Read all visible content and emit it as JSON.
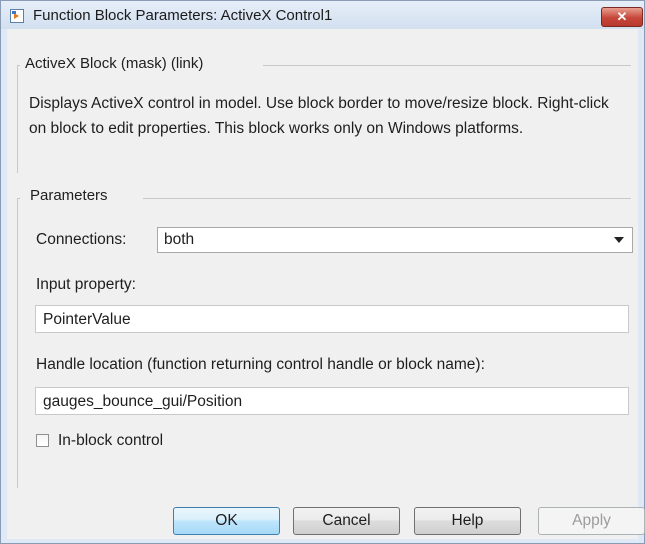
{
  "window": {
    "title": "Function Block Parameters: ActiveX Control1",
    "close_glyph": "✕",
    "title_icon": "simulink-block-icon"
  },
  "block_group": {
    "label": "ActiveX Block (mask) (link)",
    "description": "Displays ActiveX control in model. Use block border to move/resize block. Right-click on block to edit properties. This block works only on Windows platforms."
  },
  "parameters": {
    "label": "Parameters",
    "connections_label": "Connections:",
    "connections_value": "both",
    "input_property_label": "Input property:",
    "input_property_value": "PointerValue",
    "handle_location_label": "Handle location (function returning control handle or block name):",
    "handle_location_value": "gauges_bounce_gui/Position",
    "in_block_control_label": "In-block control",
    "in_block_control_checked": false
  },
  "buttons": {
    "ok": "OK",
    "cancel": "Cancel",
    "help": "Help",
    "apply": "Apply"
  }
}
